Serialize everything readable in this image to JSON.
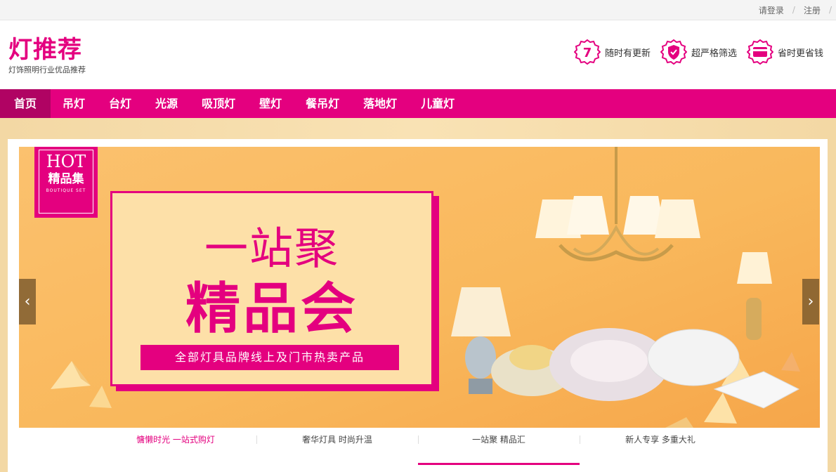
{
  "topbar": {
    "login": "请登录",
    "register": "注册"
  },
  "logo": {
    "title": "灯推荐",
    "subtitle": "灯饰照明行业优品推荐"
  },
  "features": [
    {
      "icon": "seven-day-icon",
      "icon_text": "7",
      "label": "随时有更新"
    },
    {
      "icon": "shield-icon",
      "label": "超严格筛选"
    },
    {
      "icon": "card-icon",
      "label": "省时更省钱"
    }
  ],
  "nav": [
    {
      "label": "首页",
      "active": true
    },
    {
      "label": "吊灯"
    },
    {
      "label": "台灯"
    },
    {
      "label": "光源"
    },
    {
      "label": "吸顶灯"
    },
    {
      "label": "壁灯"
    },
    {
      "label": "餐吊灯"
    },
    {
      "label": "落地灯"
    },
    {
      "label": "儿童灯"
    }
  ],
  "banner": {
    "hot_title": "HOT",
    "hot_subtitle": "精品集",
    "hot_caption": "BOUTIQUE SET",
    "headline": "一站聚",
    "headline2": "精品会",
    "tagline": "全部灯具品牌线上及门市热卖产品",
    "prev": "‹",
    "next": "›"
  },
  "tabs": [
    {
      "label": "慵懒时光 一站式购灯"
    },
    {
      "label": "奢华灯具 时尚升温"
    },
    {
      "label": "一站聚 精品汇",
      "active": true
    },
    {
      "label": "新人专享 多重大礼"
    }
  ],
  "colors": {
    "brand": "#e4007f",
    "brand_dark": "#b00363",
    "banner_bg": "#f9b85c"
  }
}
